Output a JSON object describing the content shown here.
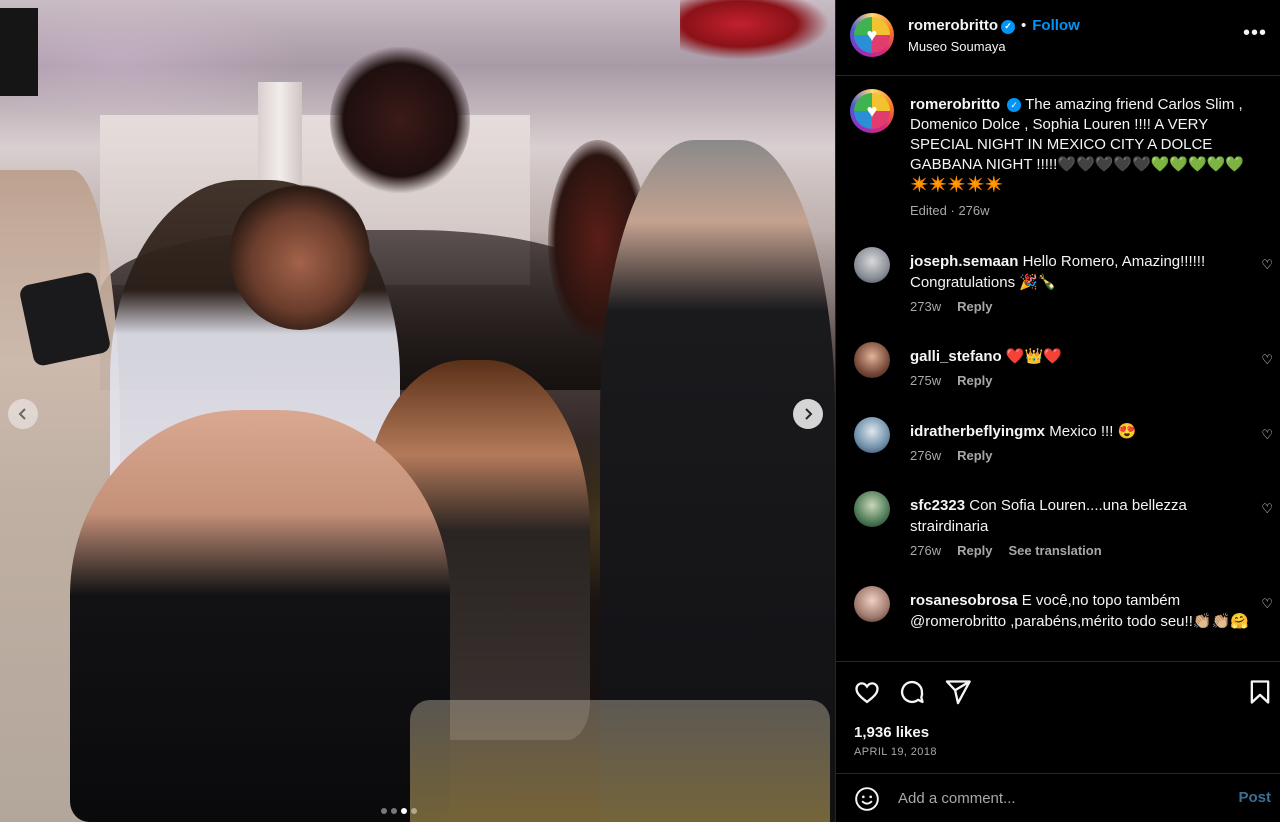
{
  "post": {
    "username": "romerobritto",
    "verified": true,
    "follow_label": "Follow",
    "location": "Museo Soumaya",
    "more_icon": "more-options-icon"
  },
  "caption": {
    "username": "romerobritto",
    "text": "The amazing friend Carlos Slim , Domenico Dolce , Sophia Louren !!!! A VERY SPECIAL NIGHT IN MEXICO CITY A DOLCE GABBANA NIGHT !!!!!🖤🖤🖤🖤🖤💚💚💚💚💚✴️✴️✴️✴️✴️",
    "edited_label": "Edited",
    "age": "276w"
  },
  "comments": [
    {
      "username": "joseph.semaan",
      "text": "Hello Romero, Amazing!!!!!! Congratulations 🎉🍾",
      "age": "273w",
      "reply_label": "Reply",
      "avatar_color": "#8a8f98"
    },
    {
      "username": "galli_stefano",
      "text": "❤️👑❤️",
      "age": "275w",
      "reply_label": "Reply",
      "avatar_color": "#7a4a3a"
    },
    {
      "username": "idratherbeflyingmx",
      "text": "Mexico !!! 😍",
      "age": "276w",
      "reply_label": "Reply",
      "avatar_color": "#6f8faa"
    },
    {
      "username": "sfc2323",
      "text": "Con Sofia Louren....una bellezza strairdinaria",
      "age": "276w",
      "reply_label": "Reply",
      "translation_label": "See translation",
      "avatar_color": "#4d7a56"
    },
    {
      "username": "rosanesobrosa",
      "text": "E você,no topo também @romerobritto ,parabéns,mérito todo seu!!👏🏼👏🏼🤗",
      "avatar_color": "#a07a6e"
    }
  ],
  "engagement": {
    "likes": "1,936 likes",
    "date": "APRIL 19, 2018"
  },
  "composer": {
    "placeholder": "Add a comment...",
    "post_label": "Post"
  },
  "carousel": {
    "prev_icon": "chevron-left-icon",
    "next_icon": "chevron-right-icon",
    "slide_count": 4,
    "active_slide": 3
  },
  "colors": {
    "accent": "#0095f6",
    "secondary_text": "#a8a8a8",
    "divider": "#262626"
  }
}
